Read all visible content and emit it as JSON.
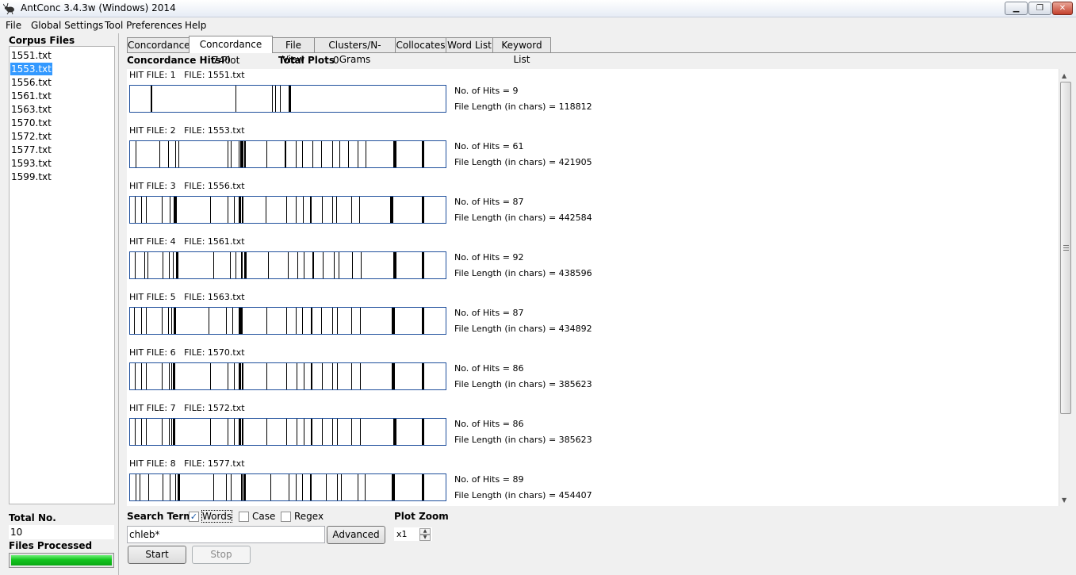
{
  "window": {
    "title": "AntConc 3.4.3w (Windows) 2014",
    "minimize": "▁",
    "restore": "❐",
    "close": "✕"
  },
  "menu": [
    "File",
    "Global Settings",
    "Tool Preferences",
    "Help"
  ],
  "corpus": {
    "title": "Corpus Files",
    "files": [
      "1551.txt",
      "1553.txt",
      "1556.txt",
      "1561.txt",
      "1563.txt",
      "1570.txt",
      "1572.txt",
      "1577.txt",
      "1593.txt",
      "1599.txt"
    ],
    "selected_index": 1,
    "total_label": "Total No.",
    "total_value": "10",
    "processed_label": "Files Processed",
    "processed_progress": 1.0
  },
  "tabs": [
    "Concordance",
    "Concordance Plot",
    "File View",
    "Clusters/N-Grams",
    "Collocates",
    "Word List",
    "Keyword List"
  ],
  "active_tab": 1,
  "summary": {
    "hits_label": "Concordance Hits",
    "hits_value": "740",
    "plots_label": "Total Plots",
    "plots_value": "0"
  },
  "plots": [
    {
      "head": "HIT FILE: 1   FILE: 1551.txt",
      "hits": "No. of Hits = 9",
      "length": "File Length (in chars) = 118812",
      "bars": [
        [
          0.066,
          2
        ],
        [
          0.333,
          1
        ],
        [
          0.451,
          1
        ],
        [
          0.461,
          1
        ],
        [
          0.474,
          1
        ],
        [
          0.502,
          3
        ]
      ]
    },
    {
      "head": "HIT FILE: 2   FILE: 1553.txt",
      "hits": "No. of Hits = 61",
      "length": "File Length (in chars) = 421905",
      "bars": [
        [
          0.018,
          1
        ],
        [
          0.094,
          1
        ],
        [
          0.121,
          1
        ],
        [
          0.143,
          1
        ],
        [
          0.153,
          1
        ],
        [
          0.31,
          1
        ],
        [
          0.319,
          1
        ],
        [
          0.343,
          1
        ],
        [
          0.349,
          4
        ],
        [
          0.361,
          2
        ],
        [
          0.433,
          1
        ],
        [
          0.49,
          1
        ],
        [
          0.493,
          1
        ],
        [
          0.526,
          1
        ],
        [
          0.546,
          1
        ],
        [
          0.579,
          1
        ],
        [
          0.606,
          1
        ],
        [
          0.641,
          1
        ],
        [
          0.664,
          1
        ],
        [
          0.69,
          1
        ],
        [
          0.72,
          1
        ],
        [
          0.745,
          1
        ],
        [
          0.833,
          4
        ],
        [
          0.925,
          3
        ]
      ]
    },
    {
      "head": "HIT FILE: 3   FILE: 1556.txt",
      "hits": "No. of Hits = 87",
      "length": "File Length (in chars) = 442584",
      "bars": [
        [
          0.015,
          1
        ],
        [
          0.035,
          1
        ],
        [
          0.049,
          1
        ],
        [
          0.1,
          1
        ],
        [
          0.125,
          1
        ],
        [
          0.138,
          1
        ],
        [
          0.141,
          3
        ],
        [
          0.253,
          1
        ],
        [
          0.31,
          1
        ],
        [
          0.329,
          1
        ],
        [
          0.344,
          3
        ],
        [
          0.355,
          2
        ],
        [
          0.43,
          1
        ],
        [
          0.495,
          1
        ],
        [
          0.526,
          1
        ],
        [
          0.547,
          1
        ],
        [
          0.571,
          2
        ],
        [
          0.607,
          1
        ],
        [
          0.64,
          1
        ],
        [
          0.653,
          1
        ],
        [
          0.7,
          1
        ],
        [
          0.725,
          1
        ],
        [
          0.825,
          4
        ],
        [
          0.925,
          3
        ]
      ]
    },
    {
      "head": "HIT FILE: 4   FILE: 1561.txt",
      "hits": "No. of Hits = 92",
      "length": "File Length (in chars) = 438596",
      "bars": [
        [
          0.015,
          1
        ],
        [
          0.045,
          1
        ],
        [
          0.055,
          1
        ],
        [
          0.103,
          1
        ],
        [
          0.124,
          1
        ],
        [
          0.135,
          1
        ],
        [
          0.145,
          3
        ],
        [
          0.263,
          1
        ],
        [
          0.317,
          1
        ],
        [
          0.333,
          1
        ],
        [
          0.353,
          2
        ],
        [
          0.363,
          3
        ],
        [
          0.436,
          1
        ],
        [
          0.5,
          1
        ],
        [
          0.53,
          1
        ],
        [
          0.55,
          1
        ],
        [
          0.579,
          2
        ],
        [
          0.61,
          1
        ],
        [
          0.645,
          1
        ],
        [
          0.66,
          1
        ],
        [
          0.703,
          1
        ],
        [
          0.73,
          1
        ],
        [
          0.833,
          4
        ],
        [
          0.925,
          3
        ]
      ]
    },
    {
      "head": "HIT FILE: 5   FILE: 1563.txt",
      "hits": "No. of Hits = 87",
      "length": "File Length (in chars) = 434892",
      "bars": [
        [
          0.013,
          1
        ],
        [
          0.035,
          1
        ],
        [
          0.049,
          1
        ],
        [
          0.1,
          1
        ],
        [
          0.12,
          1
        ],
        [
          0.131,
          1
        ],
        [
          0.138,
          3
        ],
        [
          0.248,
          1
        ],
        [
          0.303,
          1
        ],
        [
          0.325,
          1
        ],
        [
          0.343,
          3
        ],
        [
          0.353,
          2
        ],
        [
          0.433,
          1
        ],
        [
          0.495,
          1
        ],
        [
          0.525,
          1
        ],
        [
          0.545,
          1
        ],
        [
          0.573,
          2
        ],
        [
          0.605,
          1
        ],
        [
          0.64,
          1
        ],
        [
          0.655,
          1
        ],
        [
          0.7,
          1
        ],
        [
          0.728,
          1
        ],
        [
          0.828,
          4
        ],
        [
          0.925,
          3
        ]
      ]
    },
    {
      "head": "HIT FILE: 6   FILE: 1570.txt",
      "hits": "No. of Hits = 86",
      "length": "File Length (in chars) = 385623",
      "bars": [
        [
          0.015,
          1
        ],
        [
          0.036,
          1
        ],
        [
          0.05,
          1
        ],
        [
          0.1,
          1
        ],
        [
          0.123,
          1
        ],
        [
          0.13,
          1
        ],
        [
          0.136,
          3
        ],
        [
          0.253,
          1
        ],
        [
          0.31,
          1
        ],
        [
          0.329,
          1
        ],
        [
          0.344,
          3
        ],
        [
          0.355,
          2
        ],
        [
          0.433,
          1
        ],
        [
          0.495,
          1
        ],
        [
          0.528,
          1
        ],
        [
          0.549,
          1
        ],
        [
          0.574,
          2
        ],
        [
          0.607,
          1
        ],
        [
          0.64,
          1
        ],
        [
          0.655,
          1
        ],
        [
          0.7,
          1
        ],
        [
          0.728,
          1
        ],
        [
          0.828,
          4
        ],
        [
          0.925,
          3
        ]
      ]
    },
    {
      "head": "HIT FILE: 7   FILE: 1572.txt",
      "hits": "No. of Hits = 86",
      "length": "File Length (in chars) = 385623",
      "bars": [
        [
          0.015,
          1
        ],
        [
          0.036,
          1
        ],
        [
          0.05,
          1
        ],
        [
          0.1,
          1
        ],
        [
          0.123,
          1
        ],
        [
          0.13,
          1
        ],
        [
          0.136,
          3
        ],
        [
          0.253,
          1
        ],
        [
          0.31,
          1
        ],
        [
          0.329,
          1
        ],
        [
          0.344,
          3
        ],
        [
          0.355,
          2
        ],
        [
          0.433,
          1
        ],
        [
          0.495,
          1
        ],
        [
          0.528,
          1
        ],
        [
          0.549,
          1
        ],
        [
          0.574,
          2
        ],
        [
          0.607,
          1
        ],
        [
          0.64,
          1
        ],
        [
          0.655,
          1
        ],
        [
          0.7,
          1
        ],
        [
          0.728,
          1
        ],
        [
          0.833,
          4
        ],
        [
          0.925,
          3
        ]
      ]
    },
    {
      "head": "HIT FILE: 8   FILE: 1577.txt",
      "hits": "No. of Hits = 89",
      "length": "File Length (in chars) = 454407",
      "bars": [
        [
          0.018,
          1
        ],
        [
          0.03,
          1
        ],
        [
          0.057,
          1
        ],
        [
          0.104,
          1
        ],
        [
          0.126,
          1
        ],
        [
          0.143,
          1
        ],
        [
          0.15,
          3
        ],
        [
          0.263,
          1
        ],
        [
          0.305,
          1
        ],
        [
          0.32,
          1
        ],
        [
          0.351,
          2
        ],
        [
          0.36,
          3
        ],
        [
          0.445,
          1
        ],
        [
          0.503,
          1
        ],
        [
          0.526,
          1
        ],
        [
          0.546,
          1
        ],
        [
          0.571,
          2
        ],
        [
          0.62,
          1
        ],
        [
          0.656,
          1
        ],
        [
          0.668,
          1
        ],
        [
          0.722,
          1
        ],
        [
          0.743,
          1
        ],
        [
          0.828,
          4
        ],
        [
          0.925,
          3
        ]
      ]
    }
  ],
  "controls": {
    "search_label": "Search Term",
    "words_label": "Words",
    "words_checked": true,
    "case_label": "Case",
    "case_checked": false,
    "regex_label": "Regex",
    "regex_checked": false,
    "search_value": "chleb*",
    "advanced_label": "Advanced",
    "start_label": "Start",
    "stop_label": "Stop",
    "zoom_label": "Plot Zoom",
    "zoom_value": "x1",
    "check_glyph": "✓",
    "spin_up": "▲",
    "spin_down": "▼",
    "scroll_up": "▲",
    "scroll_down": "▼"
  }
}
